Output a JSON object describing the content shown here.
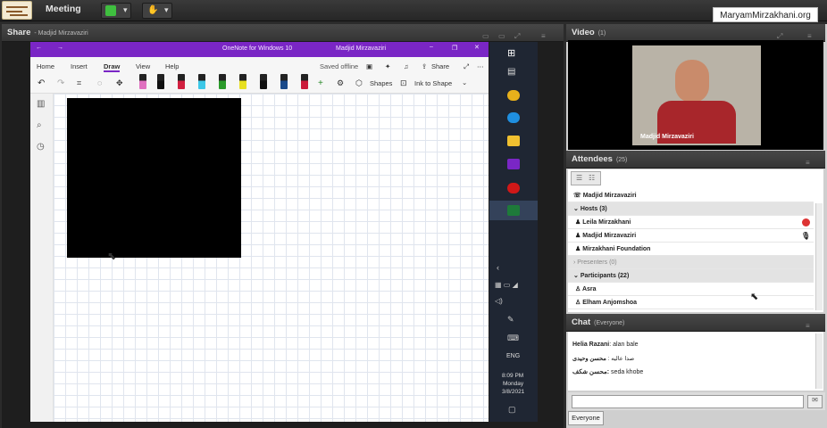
{
  "topbar": {
    "title": "Meeting",
    "brand": "MaryamMirzakhani.org"
  },
  "share": {
    "title": "Share",
    "presenter": "- Madjid Mirzavaziri"
  },
  "onenote": {
    "app_title": "OneNote for Windows 10",
    "user": "Madjid Mirzavaziri",
    "tabs": [
      "Home",
      "Insert",
      "Draw",
      "View",
      "Help"
    ],
    "status": "Saved offline",
    "share_label": "Share",
    "shapes_label": "Shapes",
    "ink_to_shape_label": "Ink to Shape",
    "pen_colors": [
      "#e070c0",
      "#111111",
      "#d22040",
      "#3cc8e8",
      "#2a9a2a",
      "#e8e020",
      "#111111",
      "#1a4a8a",
      "#cc1a3a"
    ]
  },
  "taskbar": {
    "lang": "ENG",
    "time": "8:09 PM",
    "day": "Monday",
    "date": "3/8/2021"
  },
  "video": {
    "title": "Video",
    "count": "(1)",
    "name": "Madjid Mirzavaziri"
  },
  "attendees": {
    "title": "Attendees",
    "count": "(25)",
    "presenter": "Madjid Mirzavaziri",
    "hosts_label": "Hosts (3)",
    "hosts": [
      "Leila Mirzakhani",
      "Madjid Mirzavaziri",
      "Mirzakhani Foundation"
    ],
    "presenters_label": "Presenters (0)",
    "participants_label": "Participants (22)",
    "participants": [
      "Asra",
      "Elham Anjomshoa"
    ]
  },
  "chat": {
    "title": "Chat",
    "scope": "(Everyone)",
    "messages": [
      {
        "sender": "Helia Razani",
        "text": ": alan bale"
      },
      {
        "sender": "صدا عالیه :",
        "text": "محسن وحیدی"
      },
      {
        "sender": "محسن شکف:",
        "text": " seda khobe"
      }
    ],
    "recipient": "Everyone"
  }
}
